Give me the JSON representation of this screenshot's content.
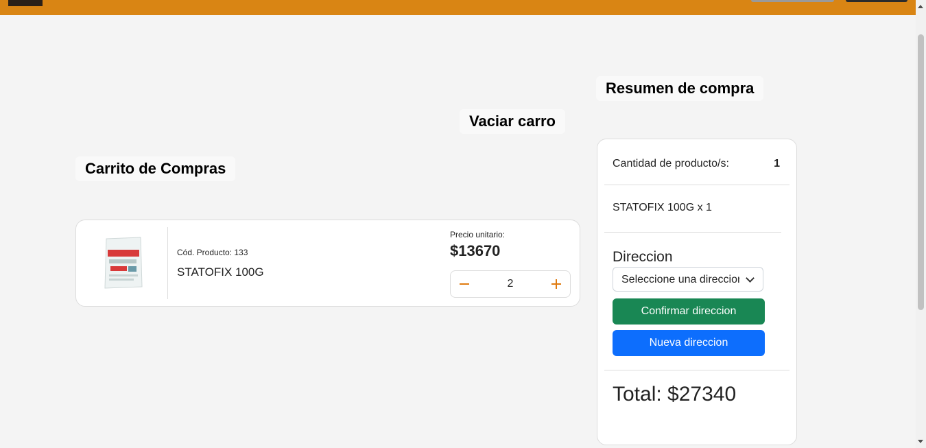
{
  "colors": {
    "topbar": "#d98514",
    "accent_stepper": "#e07b10",
    "confirm_button": "#198754",
    "new_button": "#0d6efd"
  },
  "cart": {
    "title": "Carrito de Compras",
    "empty_label": "Vaciar carro",
    "items": [
      {
        "code_label": "Cód. Producto: 133",
        "name": "STATOFIX 100G",
        "unit_price_label": "Precio unitario:",
        "unit_price": "$13670",
        "quantity": "2",
        "minus_icon": "minus-icon",
        "plus_icon": "plus-icon"
      }
    ]
  },
  "summary": {
    "title": "Resumen de compra",
    "quantity_label": "Cantidad de producto/s:",
    "quantity_value": "1",
    "line_item": "STATOFIX 100G x 1",
    "address_label": "Direccion",
    "address_select_value": "Seleccione una direccion",
    "confirm_button": "Confirmar direccion",
    "new_button": "Nueva direccion",
    "total": "Total: $27340"
  }
}
